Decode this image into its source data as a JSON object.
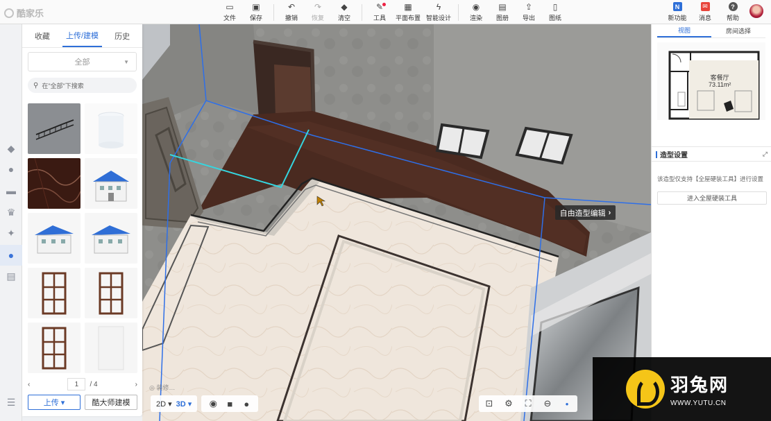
{
  "app": {
    "logo_text": "酷家乐"
  },
  "toolbar": {
    "items": [
      {
        "label": "文件",
        "icon": "file-icon"
      },
      {
        "label": "保存",
        "icon": "save-icon"
      },
      {
        "label": "撤销",
        "icon": "undo-icon"
      },
      {
        "label": "恢复",
        "icon": "redo-icon",
        "disabled": true
      },
      {
        "label": "清空",
        "icon": "eraser-icon"
      },
      {
        "label": "工具",
        "icon": "wrench-icon"
      },
      {
        "label": "平面布置",
        "icon": "layout-icon"
      },
      {
        "label": "智能设计",
        "icon": "lightning-icon"
      },
      {
        "label": "渲染",
        "icon": "render-icon"
      },
      {
        "label": "图册",
        "icon": "album-icon"
      },
      {
        "label": "导出",
        "icon": "export-icon"
      },
      {
        "label": "图纸",
        "icon": "drawing-icon"
      }
    ],
    "right": [
      {
        "label": "新功能",
        "icon": "new-feature-icon",
        "glyph": "N",
        "color": "#2e6fd8"
      },
      {
        "label": "消息",
        "icon": "gift-icon",
        "glyph": "✉",
        "color": "#e8443a"
      },
      {
        "label": "帮助",
        "icon": "help-icon",
        "glyph": "?",
        "color": "#555555"
      }
    ]
  },
  "left_panel": {
    "tabs": [
      "收藏",
      "上传/建模",
      "历史"
    ],
    "active_tab": 1,
    "category": {
      "value": "全部"
    },
    "search": {
      "placeholder": "在\"全部\"下搜索"
    },
    "pager": {
      "page": "1",
      "total": "/ 4"
    },
    "buttons": {
      "upload": "上传 ▾",
      "master": "酷大师建模"
    }
  },
  "viewport": {
    "tooltip": "自由造型编辑",
    "ghost_text": "◎ 装修…",
    "view_2d": "2D",
    "view_3d": "3D"
  },
  "right_panel": {
    "tabs": [
      "视图",
      "房间选择"
    ],
    "active_tab": 0,
    "room": {
      "name": "客餐厅",
      "area": "73.11m²"
    },
    "section_title": "造型设置",
    "note": "该造型仅支持【全屋硬装工具】进行设置",
    "enter_button": "进入全屋硬装工具"
  },
  "watermark": {
    "cn": "羽兔网",
    "en": "WWW.YUTU.CN"
  }
}
